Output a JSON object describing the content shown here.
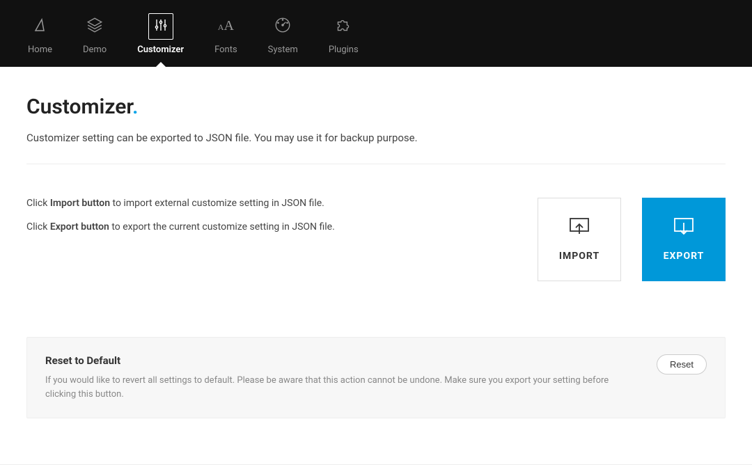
{
  "nav": {
    "items": [
      {
        "label": "Home"
      },
      {
        "label": "Demo"
      },
      {
        "label": "Customizer"
      },
      {
        "label": "Fonts"
      },
      {
        "label": "System"
      },
      {
        "label": "Plugins"
      }
    ],
    "active_index": 2
  },
  "page": {
    "title": "Customizer",
    "title_dot": ".",
    "description": "Customizer setting can be exported to JSON file. You may use it for backup purpose."
  },
  "import_export": {
    "line1_a": "Click ",
    "line1_b": "Import button",
    "line1_c": " to import external customize setting in JSON file.",
    "line2_a": "Click ",
    "line2_b": "Export button",
    "line2_c": " to export the current customize setting in JSON file.",
    "import_label": "IMPORT",
    "export_label": "EXPORT"
  },
  "reset": {
    "title": "Reset to Default",
    "description": "If you would like to revert all settings to default. Please be aware that this action cannot be undone. Make sure you export your setting before clicking this button.",
    "button_label": "Reset"
  }
}
